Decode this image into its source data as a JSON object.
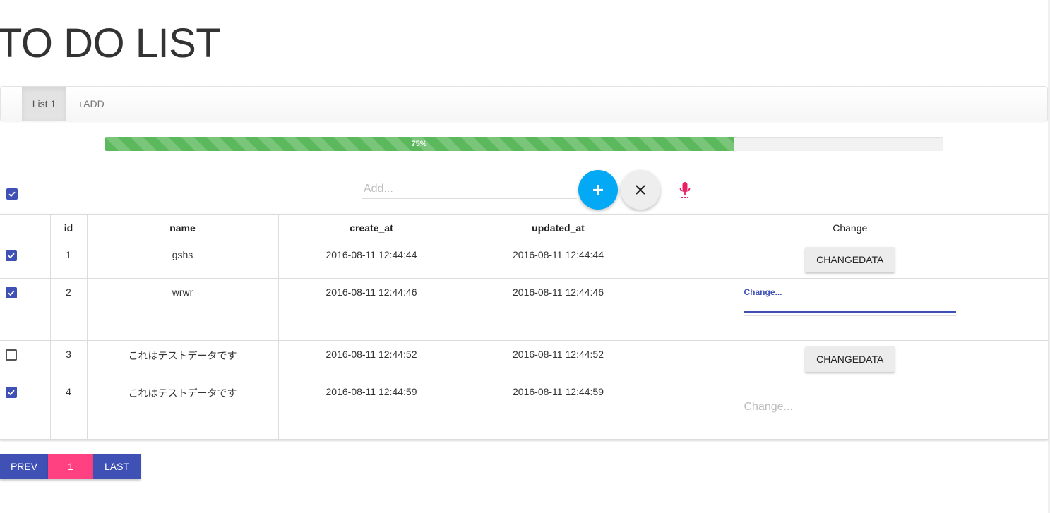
{
  "header": {
    "title": "TO DO LIST"
  },
  "tabs": [
    {
      "label": "List 1",
      "active": true
    },
    {
      "label": "+ADD",
      "active": false
    }
  ],
  "progress": {
    "percent": 75,
    "label": "75%",
    "color": "#5cb85c"
  },
  "toolbar": {
    "select_all_checked": true,
    "add_placeholder": "Add...",
    "add_value": "",
    "plus_icon": "plus-icon",
    "clear_icon": "close-icon",
    "mic_icon": "microphone-icon"
  },
  "table": {
    "columns": [
      "",
      "id",
      "name",
      "create_at",
      "updated_at",
      "Change"
    ],
    "rows": [
      {
        "checked": true,
        "id": "1",
        "name": "gshs",
        "create_at": "2016-08-11 12:44:44",
        "updated_at": "2016-08-11 12:44:44",
        "change": {
          "type": "button",
          "label": "CHANGEDATA"
        }
      },
      {
        "checked": true,
        "id": "2",
        "name": "wrwr",
        "create_at": "2016-08-11 12:44:46",
        "updated_at": "2016-08-11 12:44:46",
        "change": {
          "type": "input_focused",
          "label": "Change..."
        }
      },
      {
        "checked": false,
        "id": "3",
        "name": "これはテストデータです",
        "create_at": "2016-08-11 12:44:52",
        "updated_at": "2016-08-11 12:44:52",
        "change": {
          "type": "button",
          "label": "CHANGEDATA"
        }
      },
      {
        "checked": true,
        "id": "4",
        "name": "これはテストデータです",
        "create_at": "2016-08-11 12:44:59",
        "updated_at": "2016-08-11 12:44:59",
        "change": {
          "type": "input",
          "placeholder": "Change..."
        }
      }
    ]
  },
  "pagination": {
    "prev_label": "PREV",
    "current_page": "1",
    "last_label": "LAST"
  },
  "colors": {
    "primary": "#3f51b5",
    "accent": "#ff4081",
    "fab_blue": "#03a9f4",
    "mic": "#e91e63"
  }
}
